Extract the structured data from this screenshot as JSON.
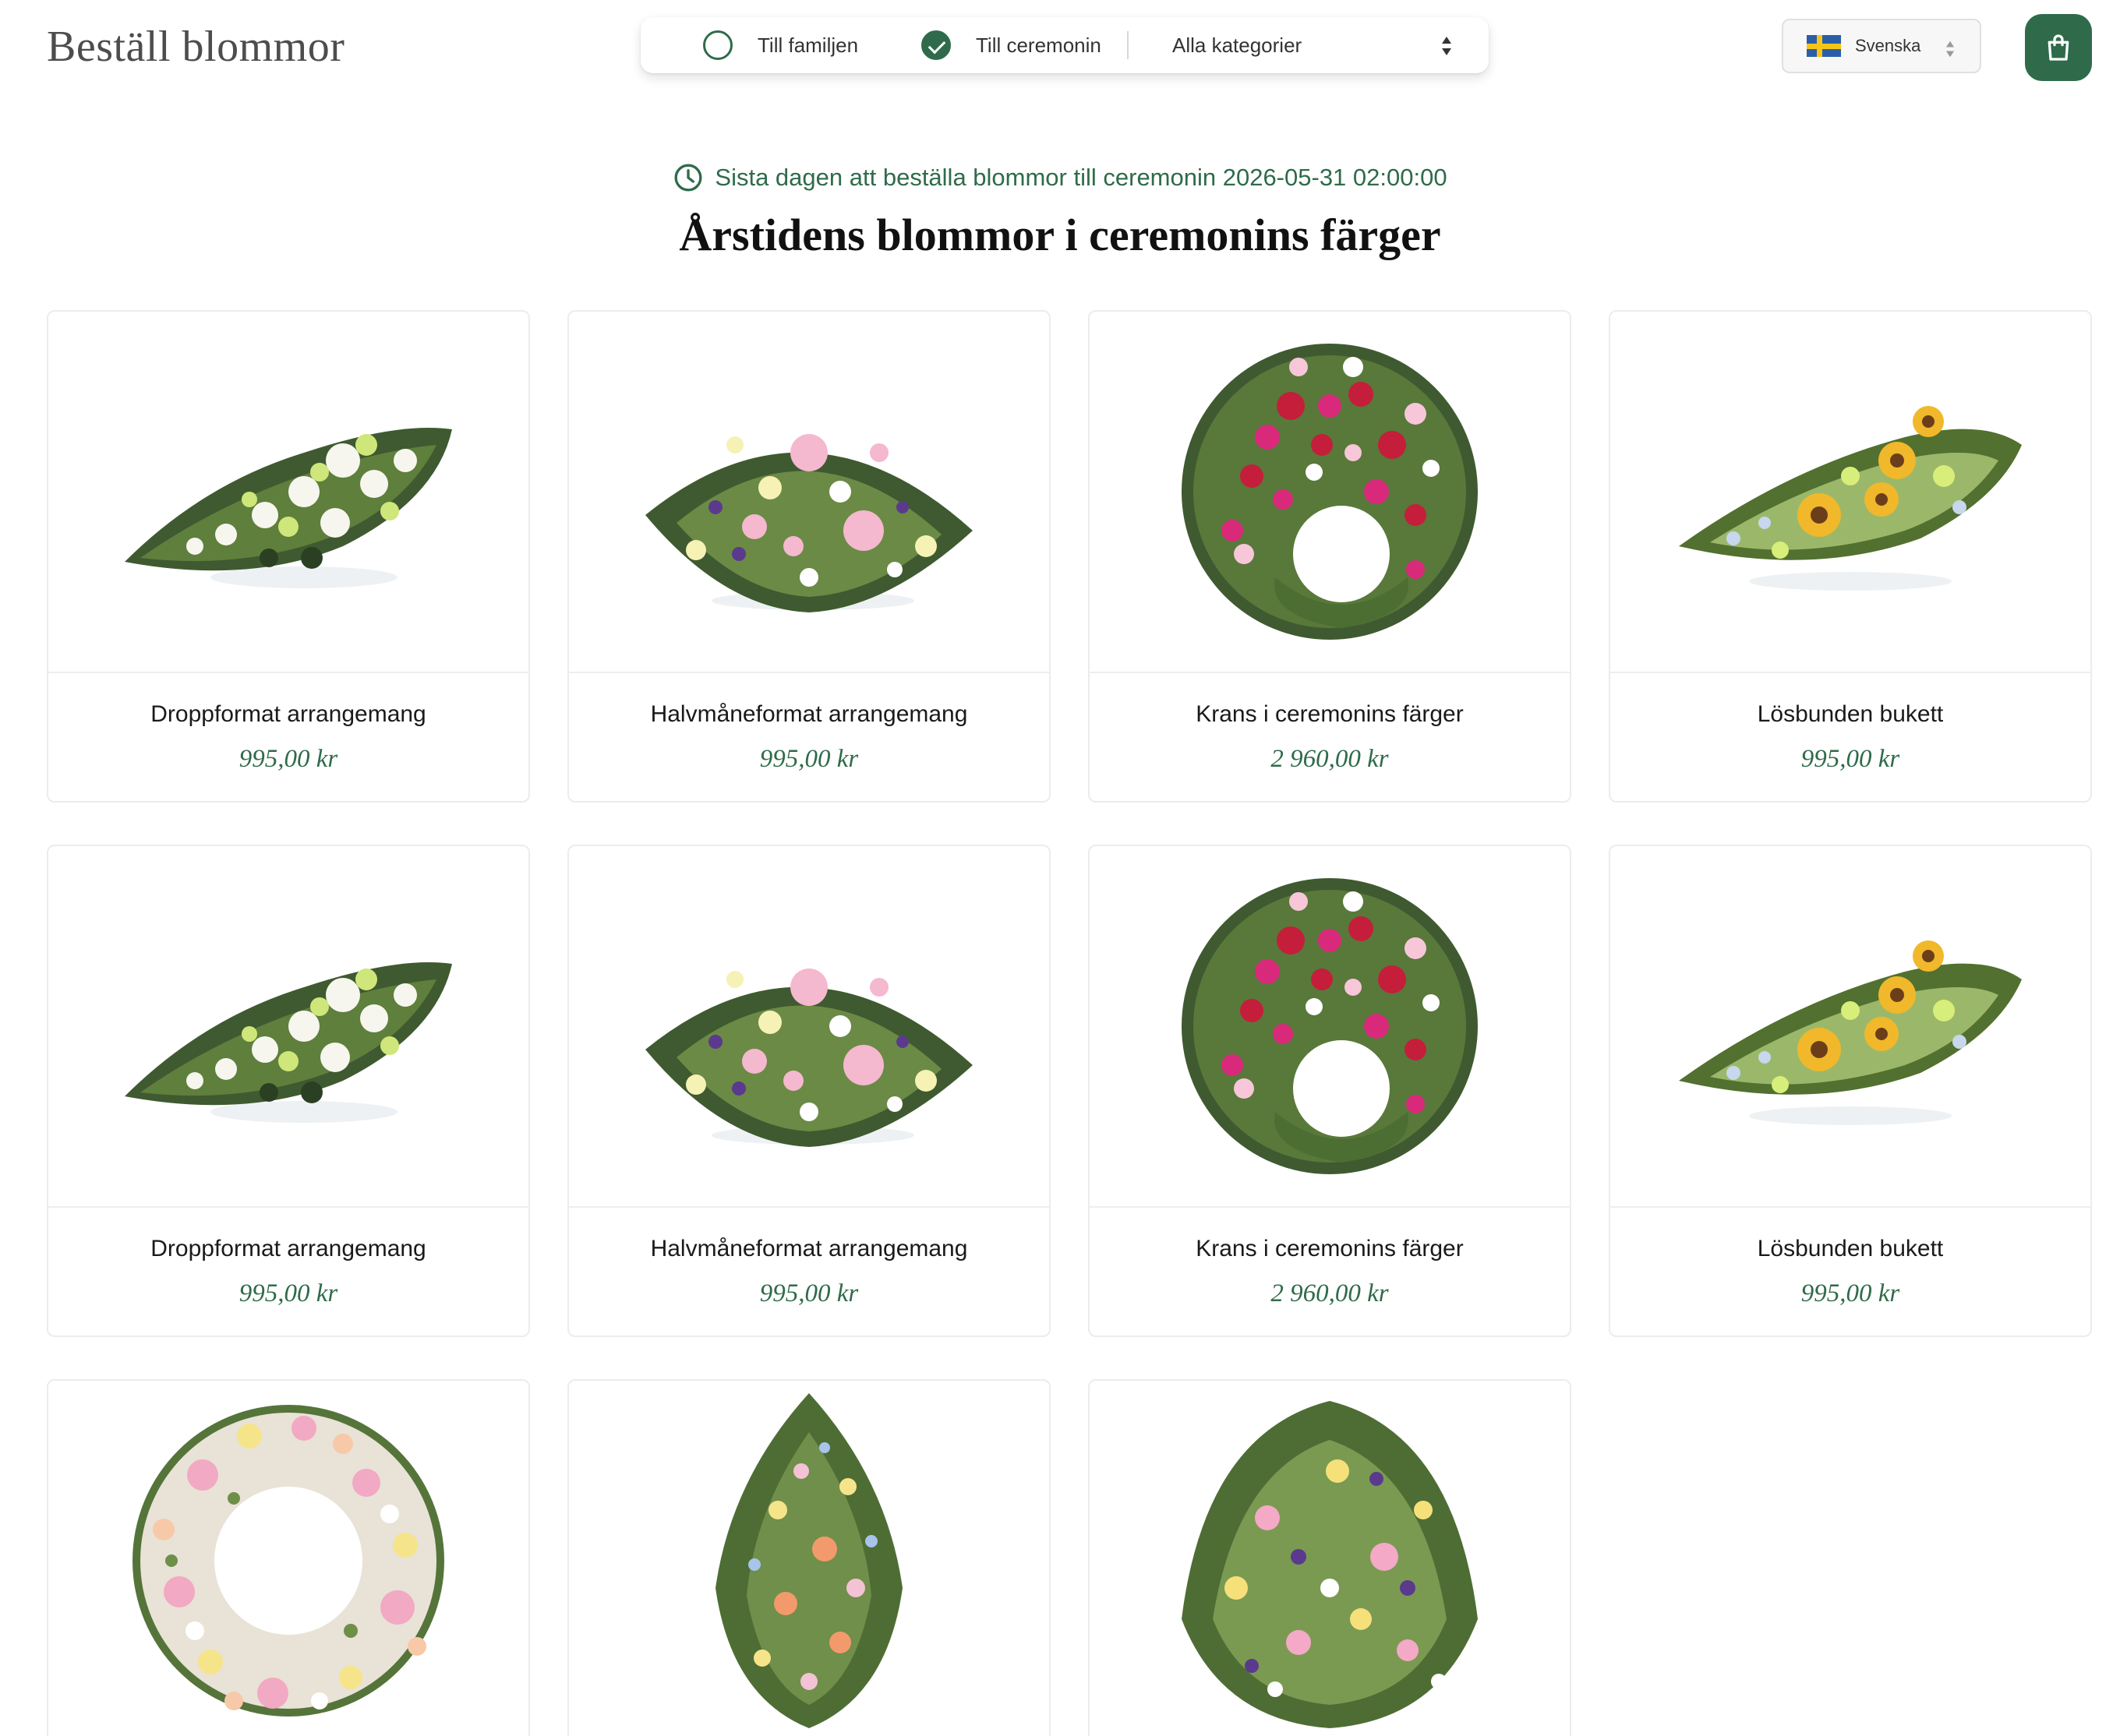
{
  "header": {
    "site_title": "Beställ blommor",
    "recipient_options": [
      {
        "label": "Till familjen",
        "selected": false
      },
      {
        "label": "Till ceremonin",
        "selected": true
      }
    ],
    "category_select": {
      "value": "Alla kategorier"
    },
    "language_select": {
      "value": "Svenska",
      "flag": "sweden-flag-icon"
    },
    "cart_icon": "shopping-bag-icon"
  },
  "intro": {
    "deadline": "Sista dagen att beställa blommor till ceremonin 2026-05-31 02:00:00",
    "title": "Årstidens blommor i ceremonins färger"
  },
  "colors": {
    "accent": "#2f6b4a",
    "card_border": "#ececec",
    "text": "#1f1f1f",
    "title_gray": "#4d4d4d"
  },
  "products": [
    {
      "name": "Droppformat arrangemang",
      "price": "995,00 kr",
      "image": "drop-arrangement-white-green"
    },
    {
      "name": "Halvmåneformat arrangemang",
      "price": "995,00 kr",
      "image": "crescent-arrangement-pastel"
    },
    {
      "name": "Krans i ceremonins färger",
      "price": "2 960,00 kr",
      "image": "wreath-red-pink"
    },
    {
      "name": "Lösbunden bukett",
      "price": "995,00 kr",
      "image": "loose-bouquet-sunflowers"
    },
    {
      "name": "Droppformat arrangemang",
      "price": "995,00 kr",
      "image": "drop-arrangement-white-green"
    },
    {
      "name": "Halvmåneformat arrangemang",
      "price": "995,00 kr",
      "image": "crescent-arrangement-pastel"
    },
    {
      "name": "Krans i ceremonins färger",
      "price": "2 960,00 kr",
      "image": "wreath-red-pink"
    },
    {
      "name": "Lösbunden bukett",
      "price": "995,00 kr",
      "image": "loose-bouquet-sunflowers"
    },
    {
      "image": "wreath-pastel-roses"
    },
    {
      "image": "tall-standing-spray"
    },
    {
      "image": "meadow-arrangement-tulips"
    }
  ]
}
